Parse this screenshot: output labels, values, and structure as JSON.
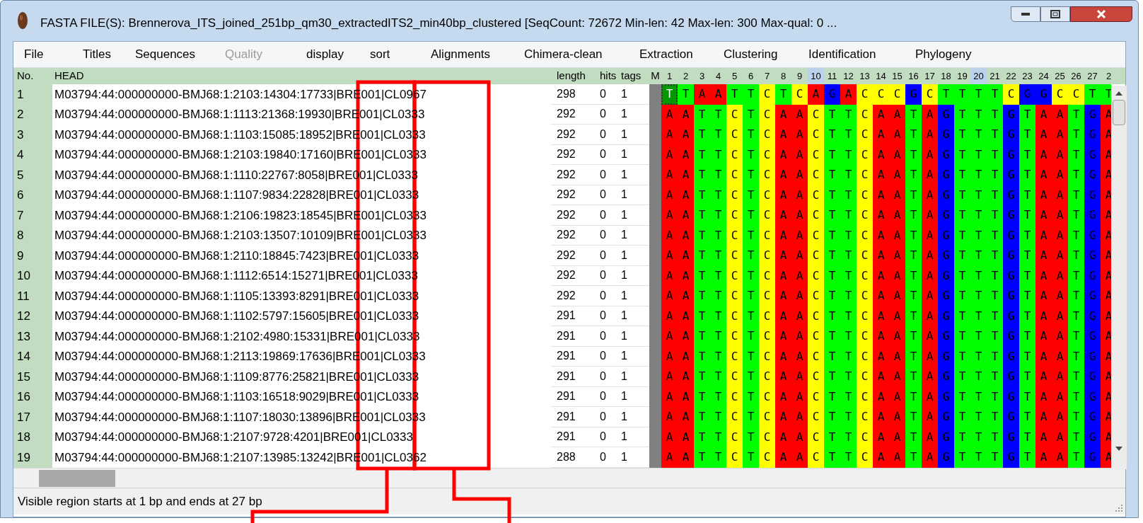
{
  "window": {
    "title": "FASTA FILE(S): Brennerova_ITS_joined_251bp_qm30_extractedITS2_min40bp_clustered [SeqCount: 72672 Min-len: 42 Max-len: 300 Max-qual: 0 ..."
  },
  "menu": [
    {
      "label": "File",
      "disabled": false
    },
    {
      "label": "Titles",
      "disabled": false
    },
    {
      "label": "Sequences",
      "disabled": false
    },
    {
      "label": "Quality",
      "disabled": true
    },
    {
      "label": "display",
      "disabled": false
    },
    {
      "label": "sort",
      "disabled": false
    },
    {
      "label": "Alignments",
      "disabled": false
    },
    {
      "label": "Chimera-clean",
      "disabled": false
    },
    {
      "label": "Extraction",
      "disabled": false
    },
    {
      "label": "Clustering",
      "disabled": false
    },
    {
      "label": "Identification",
      "disabled": false
    },
    {
      "label": "Phylogeny",
      "disabled": false
    }
  ],
  "table": {
    "columns": [
      "No.",
      "HEAD",
      "length",
      "hits",
      "tags"
    ],
    "marker": "M",
    "positions": [
      {
        "label": "1",
        "highlighted": false
      },
      {
        "label": "2",
        "highlighted": false
      },
      {
        "label": "3",
        "highlighted": false
      },
      {
        "label": "4",
        "highlighted": false
      },
      {
        "label": "5",
        "highlighted": false
      },
      {
        "label": "6",
        "highlighted": false
      },
      {
        "label": "7",
        "highlighted": false
      },
      {
        "label": "8",
        "highlighted": false
      },
      {
        "label": "9",
        "highlighted": false
      },
      {
        "label": "10",
        "highlighted": true
      },
      {
        "label": "11",
        "highlighted": false
      },
      {
        "label": "12",
        "highlighted": false
      },
      {
        "label": "13",
        "highlighted": false
      },
      {
        "label": "14",
        "highlighted": false
      },
      {
        "label": "15",
        "highlighted": false
      },
      {
        "label": "16",
        "highlighted": false
      },
      {
        "label": "17",
        "highlighted": false
      },
      {
        "label": "18",
        "highlighted": false
      },
      {
        "label": "19",
        "highlighted": false
      },
      {
        "label": "20",
        "highlighted": true
      },
      {
        "label": "21",
        "highlighted": false
      },
      {
        "label": "22",
        "highlighted": false
      },
      {
        "label": "23",
        "highlighted": false
      },
      {
        "label": "24",
        "highlighted": false
      },
      {
        "label": "25",
        "highlighted": false
      },
      {
        "label": "26",
        "highlighted": false
      },
      {
        "label": "27",
        "highlighted": false
      },
      {
        "label": "2",
        "highlighted": false
      }
    ],
    "rows": [
      {
        "no": "1",
        "head": "M03794:44:000000000-BMJ68:1:2103:14304:17733|BRE001|CL0967",
        "length": "298",
        "hits": "0",
        "tags": "1",
        "sequence": "T T A A T T C T C A G A C C C G C T T T T C G G C C T T",
        "cursor": true
      },
      {
        "no": "2",
        "head": "M03794:44:000000000-BMJ68:1:1113:21368:19930|BRE001|CL0333",
        "length": "292",
        "hits": "0",
        "tags": "1",
        "sequence": "A A T T C T C A A C T T C A A T A G T T T G T A A T G A",
        "cursor": false
      },
      {
        "no": "3",
        "head": "M03794:44:000000000-BMJ68:1:1103:15085:18952|BRE001|CL0333",
        "length": "292",
        "hits": "0",
        "tags": "1",
        "sequence": "A A T T C T C A A C T T C A A T A G T T T G T A A T G A",
        "cursor": false
      },
      {
        "no": "4",
        "head": "M03794:44:000000000-BMJ68:1:2103:19840:17160|BRE001|CL0333",
        "length": "292",
        "hits": "0",
        "tags": "1",
        "sequence": "A A T T C T C A A C T T C A A T A G T T T G T A A T G A",
        "cursor": false
      },
      {
        "no": "5",
        "head": "M03794:44:000000000-BMJ68:1:1110:22767:8058|BRE001|CL0333",
        "length": "292",
        "hits": "0",
        "tags": "1",
        "sequence": "A A T T C T C A A C T T C A A T A G T T T G T A A T G A",
        "cursor": false
      },
      {
        "no": "6",
        "head": "M03794:44:000000000-BMJ68:1:1107:9834:22828|BRE001|CL0333",
        "length": "292",
        "hits": "0",
        "tags": "1",
        "sequence": "A A T T C T C A A C T T C A A T A G T T T G T A A T G A",
        "cursor": false
      },
      {
        "no": "7",
        "head": "M03794:44:000000000-BMJ68:1:2106:19823:18545|BRE001|CL0333",
        "length": "292",
        "hits": "0",
        "tags": "1",
        "sequence": "A A T T C T C A A C T T C A A T A G T T T G T A A T G A",
        "cursor": false
      },
      {
        "no": "8",
        "head": "M03794:44:000000000-BMJ68:1:2103:13507:10109|BRE001|CL0333",
        "length": "292",
        "hits": "0",
        "tags": "1",
        "sequence": "A A T T C T C A A C T T C A A T A G T T T G T A A T G A",
        "cursor": false
      },
      {
        "no": "9",
        "head": "M03794:44:000000000-BMJ68:1:2110:18845:7423|BRE001|CL0333",
        "length": "292",
        "hits": "0",
        "tags": "1",
        "sequence": "A A T T C T C A A C T T C A A T A G T T T G T A A T G A",
        "cursor": false
      },
      {
        "no": "10",
        "head": "M03794:44:000000000-BMJ68:1:1112:6514:15271|BRE001|CL0333",
        "length": "292",
        "hits": "0",
        "tags": "1",
        "sequence": "A A T T C T C A A C T T C A A T A G T T T G T A A T G A",
        "cursor": false
      },
      {
        "no": "11",
        "head": "M03794:44:000000000-BMJ68:1:1105:13393:8291|BRE001|CL0333",
        "length": "292",
        "hits": "0",
        "tags": "1",
        "sequence": "A A T T C T C A A C T T C A A T A G T T T G T A A T G A",
        "cursor": false
      },
      {
        "no": "12",
        "head": "M03794:44:000000000-BMJ68:1:1102:5797:15605|BRE001|CL0333",
        "length": "291",
        "hits": "0",
        "tags": "1",
        "sequence": "A A T T C T C A A C T T C A A T A G T T T G T A A T G A",
        "cursor": false
      },
      {
        "no": "13",
        "head": "M03794:44:000000000-BMJ68:1:2102:4980:15331|BRE001|CL0333",
        "length": "291",
        "hits": "0",
        "tags": "1",
        "sequence": "A A T T C T C A A C T T C A A T A G T T T G T A A T G A",
        "cursor": false
      },
      {
        "no": "14",
        "head": "M03794:44:000000000-BMJ68:1:2113:19869:17636|BRE001|CL0333",
        "length": "291",
        "hits": "0",
        "tags": "1",
        "sequence": "A A T T C T C A A C T T C A A T A G T T T G T A A T G A",
        "cursor": false
      },
      {
        "no": "15",
        "head": "M03794:44:000000000-BMJ68:1:1109:8776:25821|BRE001|CL0333",
        "length": "291",
        "hits": "0",
        "tags": "1",
        "sequence": "A A T T C T C A A C T T C A A T A G T T T G T A A T G A",
        "cursor": false
      },
      {
        "no": "16",
        "head": "M03794:44:000000000-BMJ68:1:1103:16518:9029|BRE001|CL0333",
        "length": "291",
        "hits": "0",
        "tags": "1",
        "sequence": "A A T T C T C A A C T T C A A T A G T T T G T A A T G A",
        "cursor": false
      },
      {
        "no": "17",
        "head": "M03794:44:000000000-BMJ68:1:1107:18030:13896|BRE001|CL0333",
        "length": "291",
        "hits": "0",
        "tags": "1",
        "sequence": "A A T T C T C A A C T T C A A T A G T T T G T A A T G A",
        "cursor": false
      },
      {
        "no": "18",
        "head": "M03794:44:000000000-BMJ68:1:2107:9728:4201|BRE001|CL0333",
        "length": "291",
        "hits": "0",
        "tags": "1",
        "sequence": "A A T T C T C A A C T T C A A T A G T T T G T A A T G A",
        "cursor": false
      },
      {
        "no": "19",
        "head": "M03794:44:000000000-BMJ68:1:2107:13985:13242|BRE001|CL0362",
        "length": "288",
        "hits": "0",
        "tags": "1",
        "sequence": "A A T T C T C A A C T T C A A T A G T T T G T A A T G A",
        "cursor": false
      }
    ]
  },
  "status_bar": "Visible region starts at 1 bp and ends at 27 bp"
}
